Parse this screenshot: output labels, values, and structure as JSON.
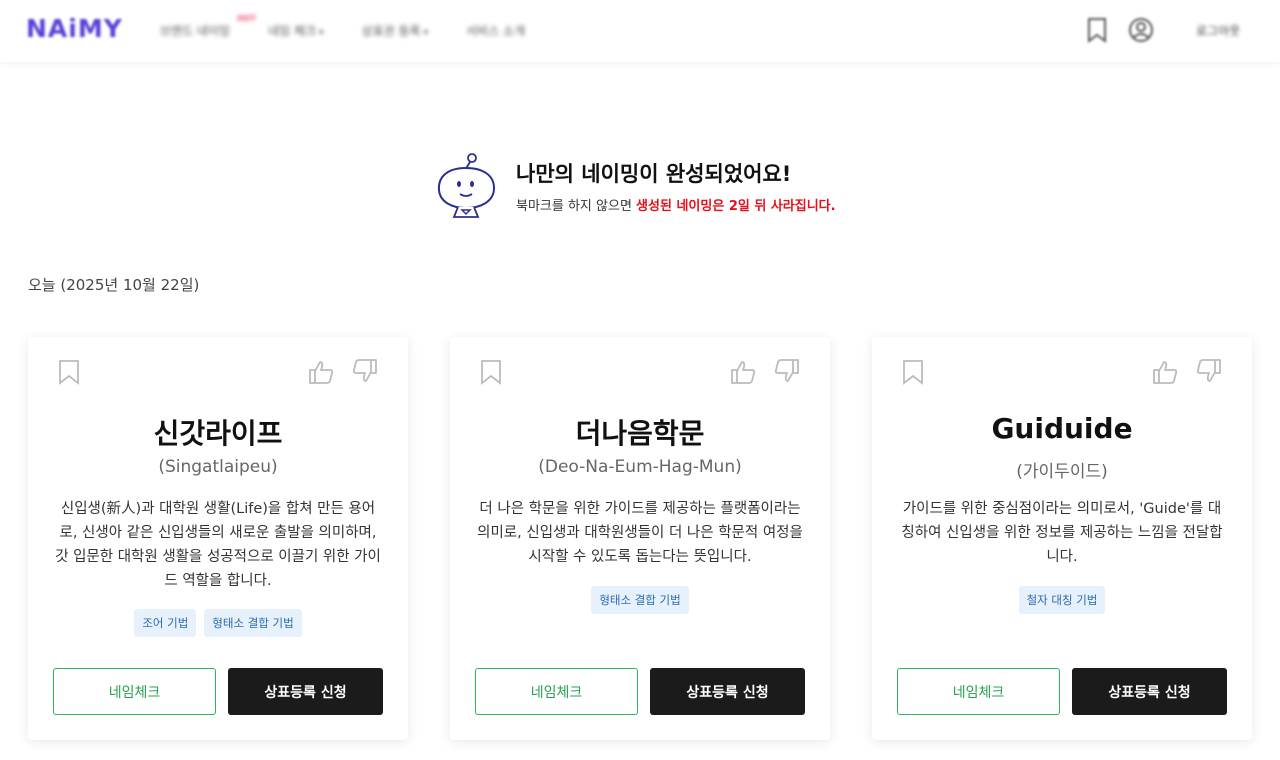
{
  "header": {
    "logo": "NAiMY",
    "nav": [
      {
        "label": "브랜드 네이밍",
        "badge": "HOT",
        "caret": ""
      },
      {
        "label": "네임 체크",
        "badge": "",
        "caret": "▾"
      },
      {
        "label": "상표권 등록",
        "badge": "",
        "caret": "▾"
      },
      {
        "label": "서비스 소개",
        "badge": "",
        "caret": ""
      }
    ],
    "login": "로그아웃"
  },
  "hero": {
    "title": "나만의 네이밍이 완성되었어요!",
    "sub_plain": "북마크를 하지 않으면 ",
    "sub_warn": "생성된 네이밍은 2일 뒤 사라집니다."
  },
  "date_label": "오늘 (2025년 10월 22일)",
  "cards": [
    {
      "name": "신갓라이프",
      "romanization": "(Singatlaipeu)",
      "description": "신입생(新人)과 대학원 생활(Life)을 합쳐 만든 용어로, 신생아 같은 신입생들의 새로운 출발을 의미하며, 갓 입문한 대학원 생활을 성공적으로 이끌기 위한 가이드 역할을 합니다.",
      "tags": [
        "조어 기법",
        "형태소 결합 기법"
      ],
      "check_label": "네임체크",
      "trademark_label": "상표등록 신청"
    },
    {
      "name": "더나음학문",
      "romanization": "(Deo-Na-Eum-Hag-Mun)",
      "description": "더 나은 학문을 위한 가이드를 제공하는 플랫폼이라는 의미로, 신입생과 대학원생들이 더 나은 학문적 여정을 시작할 수 있도록 돕는다는 뜻입니다.",
      "tags": [
        "형태소 결합 기법"
      ],
      "check_label": "네임체크",
      "trademark_label": "상표등록 신청"
    },
    {
      "name": "Guiduide",
      "romanization": "(가이두이드)",
      "description": "가이드를 위한 중심점이라는 의미로서, 'Guide'를 대칭하여 신입생을 위한 정보를 제공하는 느낌을 전달합니다.",
      "tags": [
        "철자 대칭 기법"
      ],
      "check_label": "네임체크",
      "trademark_label": "상표등록 신청"
    }
  ],
  "colors": {
    "brand": "#5a3fd8",
    "warn": "#e5101b",
    "check_green": "#27a152",
    "tag_bg": "#e6f1fb",
    "tag_text": "#2b6cb0",
    "primary_button": "#1b1b1b"
  },
  "icons": [
    "bookmark-icon",
    "user-icon",
    "mascot-icon",
    "thumbs-up-icon",
    "thumbs-down-icon"
  ]
}
